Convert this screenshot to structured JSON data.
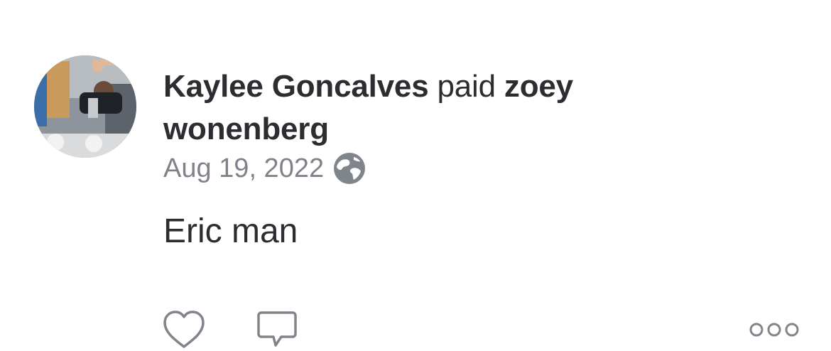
{
  "story": {
    "actor": "Kaylee Goncalves",
    "verb": "paid",
    "target": "zoey wonenberg"
  },
  "meta": {
    "date": "Aug 19, 2022",
    "privacy_icon": "globe-icon"
  },
  "note": "Eric man",
  "actions": {
    "like_icon": "heart-icon",
    "comment_icon": "comment-icon",
    "more_icon": "more-horizontal-icon"
  },
  "colors": {
    "primary_text": "#2d2d31",
    "secondary_text": "#7f8389",
    "icon_gray": "#7f8389"
  }
}
